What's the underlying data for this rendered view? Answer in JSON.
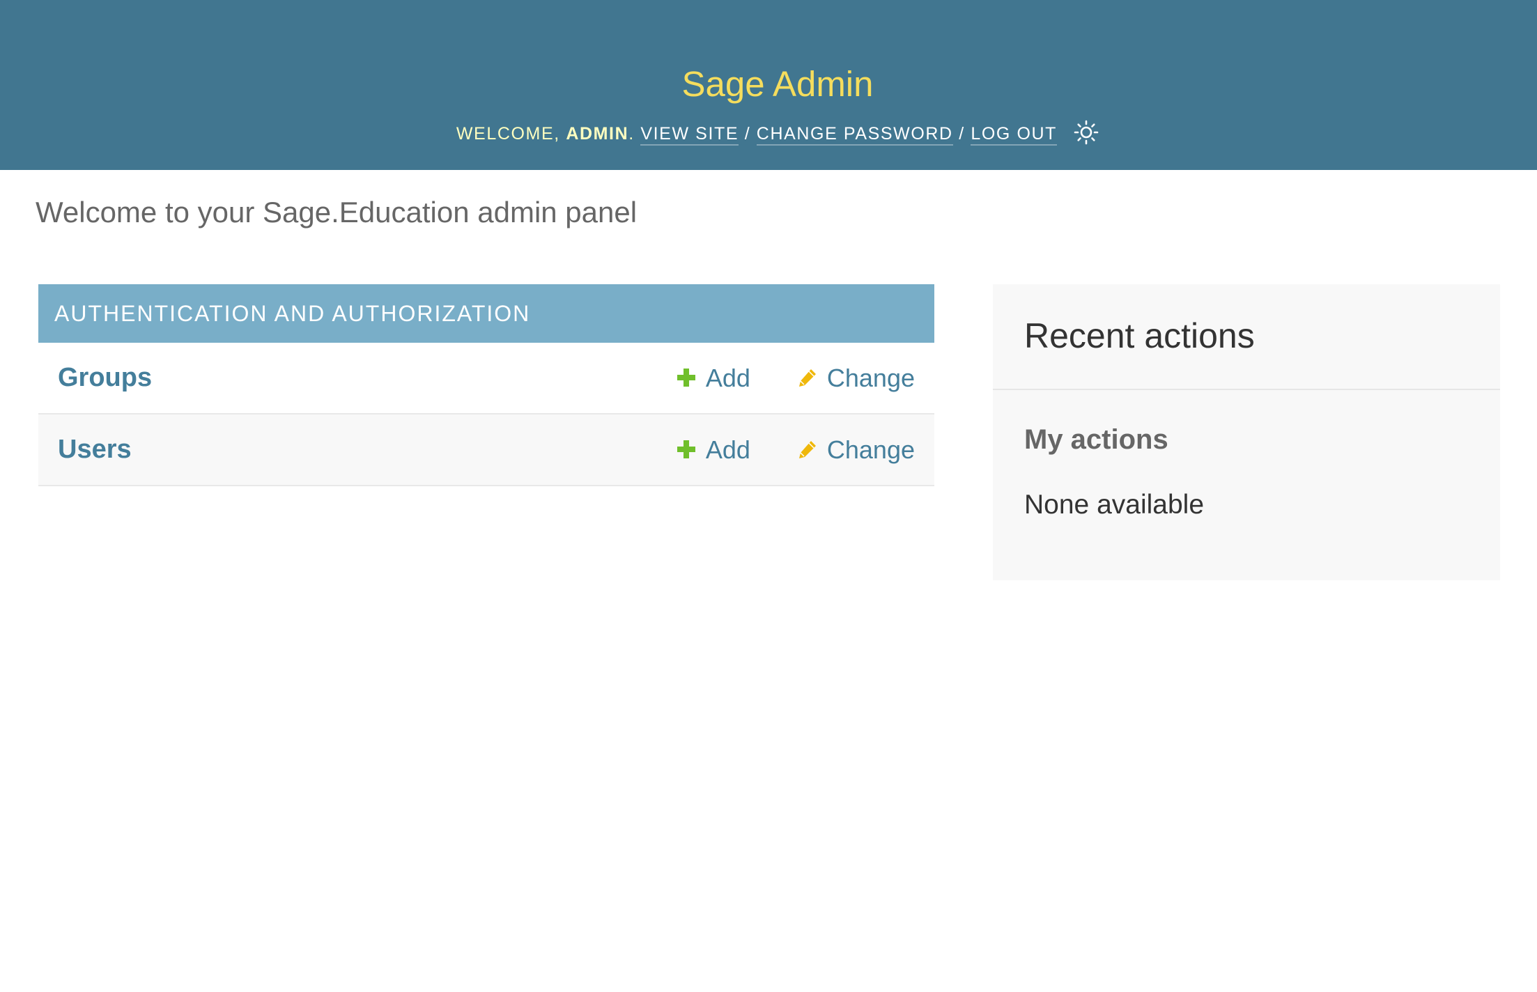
{
  "header": {
    "branding": "Sage Admin",
    "welcome_prefix": "WELCOME, ",
    "username": "ADMIN",
    "welcome_suffix": ".",
    "view_site": "VIEW SITE",
    "separator": "/",
    "change_password": "CHANGE PASSWORD",
    "log_out": "LOG OUT",
    "theme_icon": "sun-icon",
    "colors": {
      "background": "#417690",
      "branding": "#f5dd5d",
      "welcome_text": "#ffffc0"
    }
  },
  "main": {
    "welcome_text": "Welcome to your Sage.Education admin panel",
    "app_module": {
      "caption": "AUTHENTICATION AND AUTHORIZATION",
      "caption_color": "#79aec8",
      "models": [
        {
          "name": "Groups",
          "add_label": "Add",
          "change_label": "Change"
        },
        {
          "name": "Users",
          "add_label": "Add",
          "change_label": "Change"
        }
      ]
    }
  },
  "sidebar": {
    "recent_actions_title": "Recent actions",
    "my_actions_title": "My actions",
    "none_available": "None available"
  },
  "icons": {
    "add": "plus-icon",
    "change": "pencil-icon",
    "add_color": "#70bf2b",
    "change_color": "#efb80b"
  }
}
